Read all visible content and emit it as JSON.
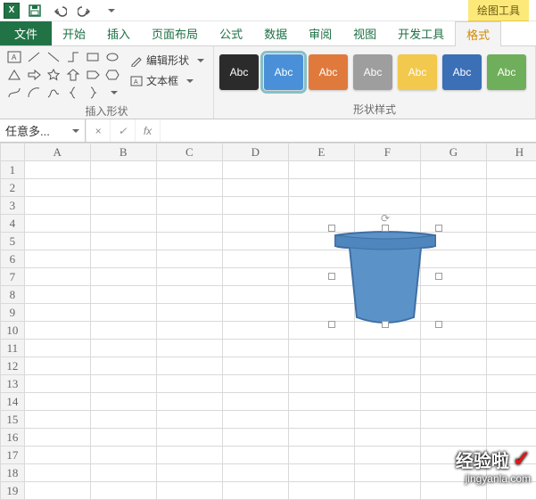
{
  "qat": {
    "excel_label": "X",
    "context_tab": "绘图工具"
  },
  "tabs": {
    "file": "文件",
    "items": [
      "开始",
      "插入",
      "页面布局",
      "公式",
      "数据",
      "审阅",
      "视图",
      "开发工具"
    ],
    "active": "格式"
  },
  "ribbon": {
    "shapes_group": "插入形状",
    "edit_shape": "编辑形状",
    "text_box": "文本框",
    "styles_group": "形状样式",
    "swatch_label": "Abc",
    "swatches": [
      {
        "bg": "#2b2b2b"
      },
      {
        "bg": "#4a90d9",
        "selected": true
      },
      {
        "bg": "#e07a3c"
      },
      {
        "bg": "#9e9e9e"
      },
      {
        "bg": "#f2c94c"
      },
      {
        "bg": "#3b6fb6"
      },
      {
        "bg": "#6fae5b"
      }
    ]
  },
  "formula": {
    "namebox": "任意多...",
    "cancel": "×",
    "ok": "✓",
    "fx": "fx",
    "value": ""
  },
  "grid": {
    "cols": [
      "A",
      "B",
      "C",
      "D",
      "E",
      "F",
      "G",
      "H"
    ],
    "rows": 19
  },
  "watermark": {
    "l1": "经验啦",
    "l2": "jingyanla.com"
  }
}
